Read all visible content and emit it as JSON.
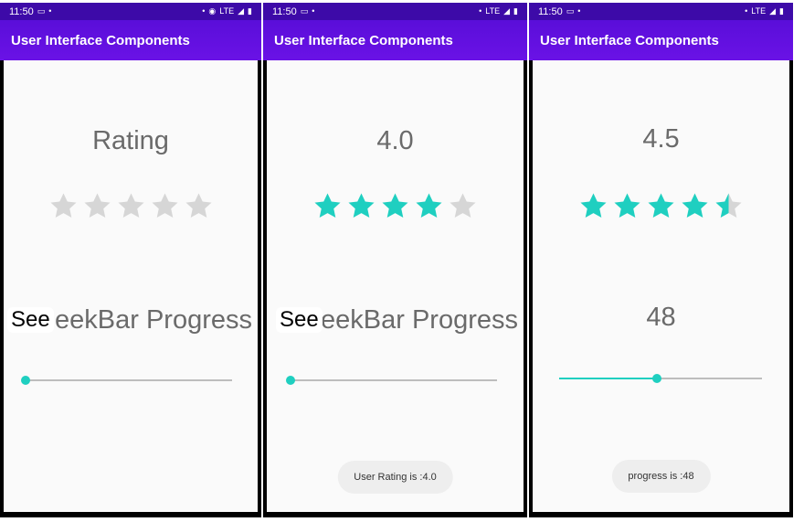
{
  "colors": {
    "accent": "#1fcfc0",
    "appbar": "#6a12e6",
    "statusbar": "#3d0aa8",
    "star_empty": "#d6d6d6",
    "text": "#6a6a6a"
  },
  "screens": [
    {
      "status": {
        "time": "11:50",
        "icons": [
          "screen-icon",
          "dot-icon",
          "dot-icon",
          "hotspot-icon",
          "lte-icon",
          "signal-icon",
          "battery-icon"
        ],
        "lte": "LTE"
      },
      "appbar_title": "User Interface Components",
      "rating_headline": "Rating",
      "rating": 0,
      "star_count": 5,
      "seek_label": "SeekBar Progress",
      "seek_overlay": "See",
      "seek_progress": 0.0,
      "toast": ""
    },
    {
      "status": {
        "time": "11:50",
        "icons": [
          "screen-icon",
          "dot-icon",
          "dot-icon",
          "lte-icon",
          "signal-icon",
          "battery-icon"
        ],
        "lte": "LTE"
      },
      "appbar_title": "User Interface Components",
      "rating_headline": "4.0",
      "rating": 4.0,
      "star_count": 5,
      "seek_label": "SeekBar Progress",
      "seek_overlay": "See",
      "seek_progress": 0.0,
      "toast": "User Rating is :4.0"
    },
    {
      "status": {
        "time": "11:50",
        "icons": [
          "screen-icon",
          "dot-icon",
          "dot-icon",
          "lte-icon",
          "signal-icon",
          "battery-icon"
        ],
        "lte": "LTE"
      },
      "appbar_title": "User Interface Components",
      "rating_headline": "4.5",
      "rating": 4.5,
      "star_count": 5,
      "seek_label": "48",
      "seek_overlay": "",
      "seek_progress": 0.48,
      "toast": "progress is :48"
    }
  ]
}
